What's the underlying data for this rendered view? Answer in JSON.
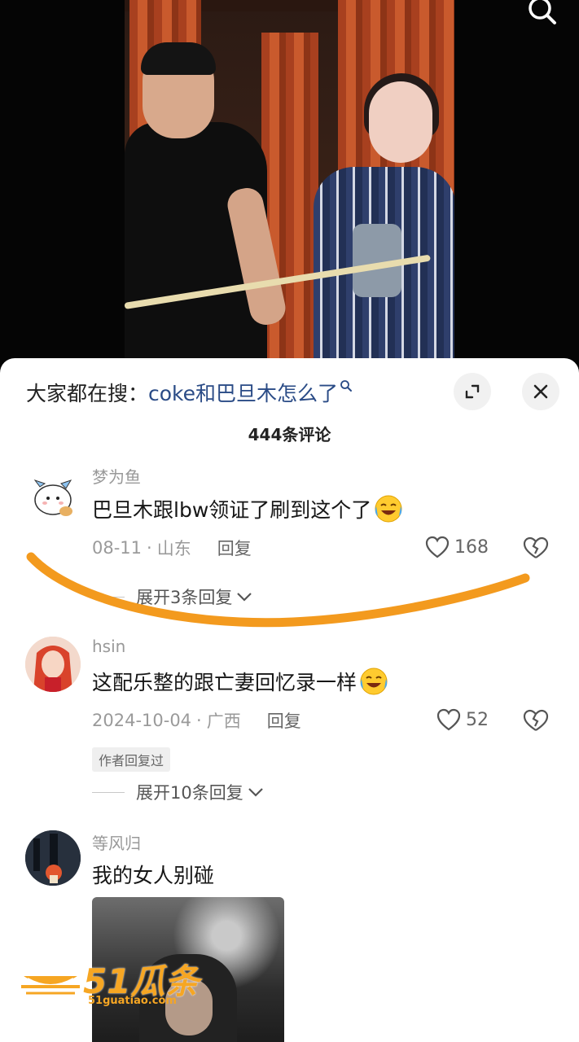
{
  "header": {
    "search_prefix": "大家都在搜：",
    "search_term": "coke和巴旦木怎么了",
    "search_term_icon": "search-icon",
    "comment_count": "444条评论"
  },
  "comments": [
    {
      "username": "梦为鱼",
      "text": "巴旦木跟lbw领证了刷到这个了",
      "emoji": "crying-laughing-emoji",
      "date": "08-11",
      "location": "山东",
      "reply_label": "回复",
      "likes": "168",
      "expand_label": "展开3条回复"
    },
    {
      "username": "hsin",
      "text": "这配乐整的跟亡妻回忆录一样",
      "emoji": "crying-laughing-emoji",
      "date": "2024-10-04",
      "location": "广西",
      "reply_label": "回复",
      "likes": "52",
      "badge": "作者回复过",
      "expand_label": "展开10条回复"
    },
    {
      "username": "等风归",
      "text": "我的女人别碰"
    }
  ],
  "watermark": {
    "brand": "51瓜条",
    "url": "51guatiao.com"
  },
  "colors": {
    "accent_link": "#2a4b86",
    "annotation_stroke": "#f39a1e",
    "watermark": "#f6a623"
  }
}
